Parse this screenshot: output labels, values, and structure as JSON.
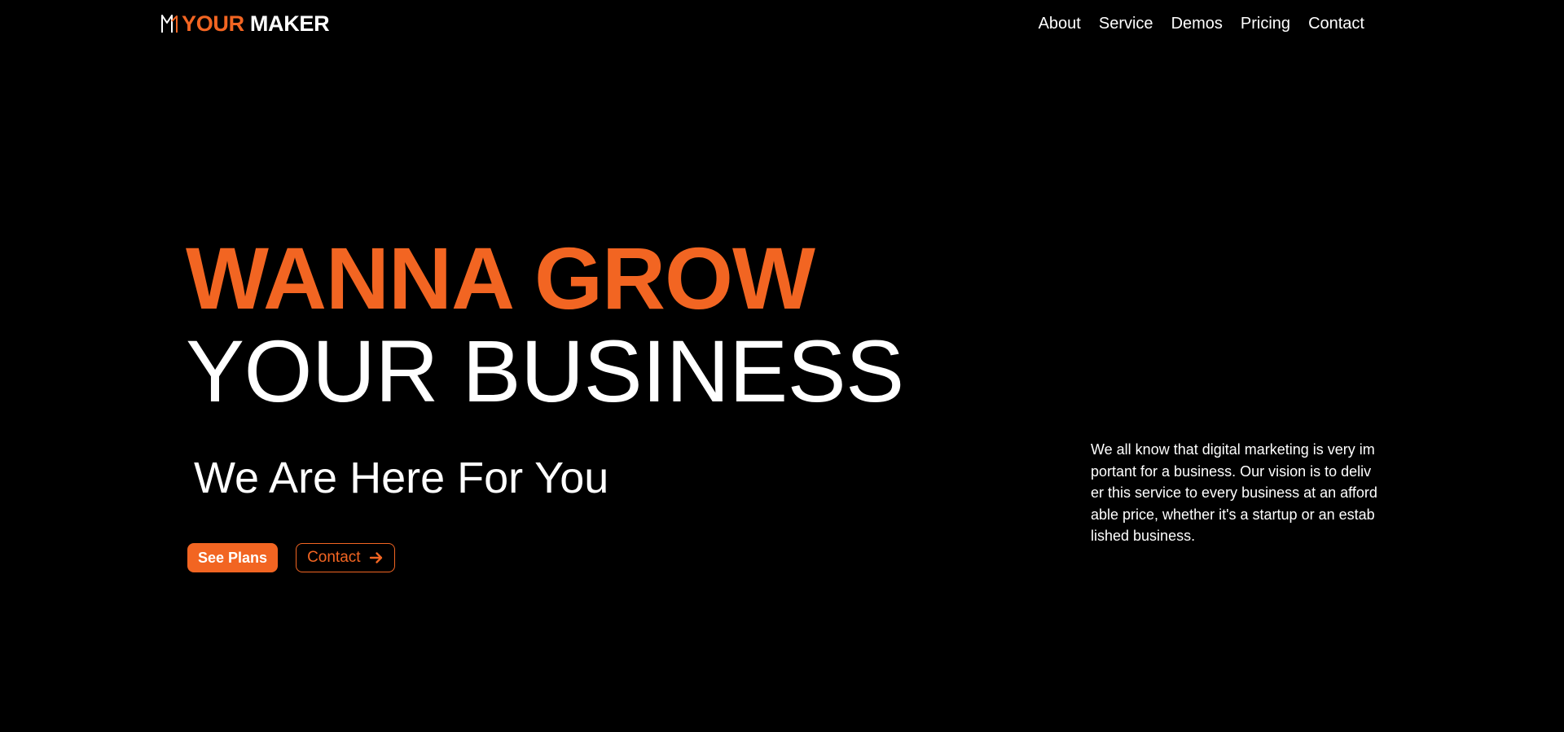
{
  "header": {
    "brand": {
      "icon": "maker-logo-icon",
      "accent_word": "YOUR",
      "light_word": "MAKER"
    },
    "nav": [
      {
        "label": "About"
      },
      {
        "label": "Service"
      },
      {
        "label": "Demos"
      },
      {
        "label": "Pricing"
      },
      {
        "label": "Contact"
      }
    ]
  },
  "hero": {
    "title_line_1": "WANNA GROW",
    "title_line_2": "YOUR BUSINESS",
    "subtitle": "We Are Here For You",
    "buttons": {
      "primary_label": "See Plans",
      "secondary_label": "Contact",
      "secondary_icon": "arrow-right-icon"
    },
    "description": "We all know that digital marketing is very important for a business. Our vision is to deliver this service to every business at an affordable price, whether it's a startup or an established business."
  },
  "colors": {
    "background": "#000000",
    "accent": "#f26522",
    "text": "#ffffff"
  }
}
